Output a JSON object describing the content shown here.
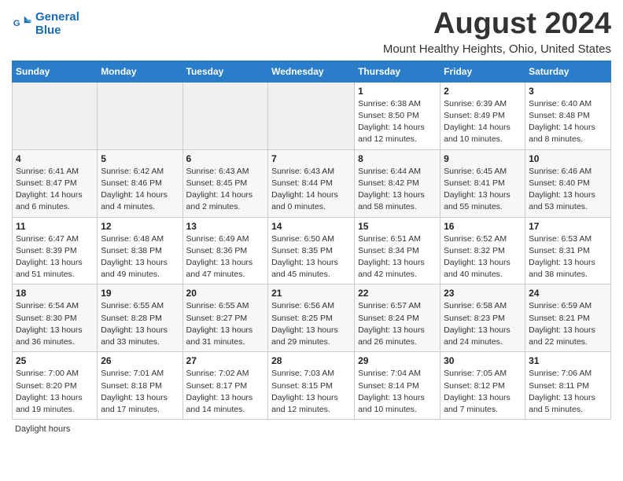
{
  "header": {
    "logo_line1": "General",
    "logo_line2": "Blue",
    "month_year": "August 2024",
    "location": "Mount Healthy Heights, Ohio, United States"
  },
  "days_of_week": [
    "Sunday",
    "Monday",
    "Tuesday",
    "Wednesday",
    "Thursday",
    "Friday",
    "Saturday"
  ],
  "footer": "Daylight hours",
  "weeks": [
    [
      {
        "day": "",
        "info": ""
      },
      {
        "day": "",
        "info": ""
      },
      {
        "day": "",
        "info": ""
      },
      {
        "day": "",
        "info": ""
      },
      {
        "day": "1",
        "info": "Sunrise: 6:38 AM\nSunset: 8:50 PM\nDaylight: 14 hours and 12 minutes."
      },
      {
        "day": "2",
        "info": "Sunrise: 6:39 AM\nSunset: 8:49 PM\nDaylight: 14 hours and 10 minutes."
      },
      {
        "day": "3",
        "info": "Sunrise: 6:40 AM\nSunset: 8:48 PM\nDaylight: 14 hours and 8 minutes."
      }
    ],
    [
      {
        "day": "4",
        "info": "Sunrise: 6:41 AM\nSunset: 8:47 PM\nDaylight: 14 hours and 6 minutes."
      },
      {
        "day": "5",
        "info": "Sunrise: 6:42 AM\nSunset: 8:46 PM\nDaylight: 14 hours and 4 minutes."
      },
      {
        "day": "6",
        "info": "Sunrise: 6:43 AM\nSunset: 8:45 PM\nDaylight: 14 hours and 2 minutes."
      },
      {
        "day": "7",
        "info": "Sunrise: 6:43 AM\nSunset: 8:44 PM\nDaylight: 14 hours and 0 minutes."
      },
      {
        "day": "8",
        "info": "Sunrise: 6:44 AM\nSunset: 8:42 PM\nDaylight: 13 hours and 58 minutes."
      },
      {
        "day": "9",
        "info": "Sunrise: 6:45 AM\nSunset: 8:41 PM\nDaylight: 13 hours and 55 minutes."
      },
      {
        "day": "10",
        "info": "Sunrise: 6:46 AM\nSunset: 8:40 PM\nDaylight: 13 hours and 53 minutes."
      }
    ],
    [
      {
        "day": "11",
        "info": "Sunrise: 6:47 AM\nSunset: 8:39 PM\nDaylight: 13 hours and 51 minutes."
      },
      {
        "day": "12",
        "info": "Sunrise: 6:48 AM\nSunset: 8:38 PM\nDaylight: 13 hours and 49 minutes."
      },
      {
        "day": "13",
        "info": "Sunrise: 6:49 AM\nSunset: 8:36 PM\nDaylight: 13 hours and 47 minutes."
      },
      {
        "day": "14",
        "info": "Sunrise: 6:50 AM\nSunset: 8:35 PM\nDaylight: 13 hours and 45 minutes."
      },
      {
        "day": "15",
        "info": "Sunrise: 6:51 AM\nSunset: 8:34 PM\nDaylight: 13 hours and 42 minutes."
      },
      {
        "day": "16",
        "info": "Sunrise: 6:52 AM\nSunset: 8:32 PM\nDaylight: 13 hours and 40 minutes."
      },
      {
        "day": "17",
        "info": "Sunrise: 6:53 AM\nSunset: 8:31 PM\nDaylight: 13 hours and 38 minutes."
      }
    ],
    [
      {
        "day": "18",
        "info": "Sunrise: 6:54 AM\nSunset: 8:30 PM\nDaylight: 13 hours and 36 minutes."
      },
      {
        "day": "19",
        "info": "Sunrise: 6:55 AM\nSunset: 8:28 PM\nDaylight: 13 hours and 33 minutes."
      },
      {
        "day": "20",
        "info": "Sunrise: 6:55 AM\nSunset: 8:27 PM\nDaylight: 13 hours and 31 minutes."
      },
      {
        "day": "21",
        "info": "Sunrise: 6:56 AM\nSunset: 8:25 PM\nDaylight: 13 hours and 29 minutes."
      },
      {
        "day": "22",
        "info": "Sunrise: 6:57 AM\nSunset: 8:24 PM\nDaylight: 13 hours and 26 minutes."
      },
      {
        "day": "23",
        "info": "Sunrise: 6:58 AM\nSunset: 8:23 PM\nDaylight: 13 hours and 24 minutes."
      },
      {
        "day": "24",
        "info": "Sunrise: 6:59 AM\nSunset: 8:21 PM\nDaylight: 13 hours and 22 minutes."
      }
    ],
    [
      {
        "day": "25",
        "info": "Sunrise: 7:00 AM\nSunset: 8:20 PM\nDaylight: 13 hours and 19 minutes."
      },
      {
        "day": "26",
        "info": "Sunrise: 7:01 AM\nSunset: 8:18 PM\nDaylight: 13 hours and 17 minutes."
      },
      {
        "day": "27",
        "info": "Sunrise: 7:02 AM\nSunset: 8:17 PM\nDaylight: 13 hours and 14 minutes."
      },
      {
        "day": "28",
        "info": "Sunrise: 7:03 AM\nSunset: 8:15 PM\nDaylight: 13 hours and 12 minutes."
      },
      {
        "day": "29",
        "info": "Sunrise: 7:04 AM\nSunset: 8:14 PM\nDaylight: 13 hours and 10 minutes."
      },
      {
        "day": "30",
        "info": "Sunrise: 7:05 AM\nSunset: 8:12 PM\nDaylight: 13 hours and 7 minutes."
      },
      {
        "day": "31",
        "info": "Sunrise: 7:06 AM\nSunset: 8:11 PM\nDaylight: 13 hours and 5 minutes."
      }
    ]
  ]
}
